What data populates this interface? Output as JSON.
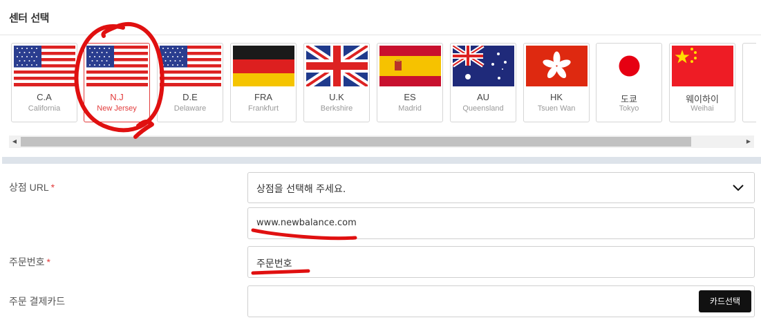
{
  "section": {
    "title": "센터 선택"
  },
  "centers": [
    {
      "code": "C.A",
      "city": "California",
      "flag": "us-flag"
    },
    {
      "code": "N.J",
      "city": "New Jersey",
      "flag": "us-flag",
      "selected": true
    },
    {
      "code": "D.E",
      "city": "Delaware",
      "flag": "us-flag"
    },
    {
      "code": "FRA",
      "city": "Frankfurt",
      "flag": "germany-flag"
    },
    {
      "code": "U.K",
      "city": "Berkshire",
      "flag": "uk-flag"
    },
    {
      "code": "ES",
      "city": "Madrid",
      "flag": "spain-flag"
    },
    {
      "code": "AU",
      "city": "Queensland",
      "flag": "australia-flag"
    },
    {
      "code": "HK",
      "city": "Tsuen Wan",
      "flag": "hong-kong-flag"
    },
    {
      "code": "도쿄",
      "city": "Tokyo",
      "flag": "japan-flag"
    },
    {
      "code": "웨이하이",
      "city": "Weihai",
      "flag": "china-flag"
    }
  ],
  "form": {
    "shop_url": {
      "label": "상점 URL",
      "required_mark": "*",
      "select_value": "상점을 선택해 주세요.",
      "url_value": "www.newbalance.com"
    },
    "order_number": {
      "label": "주문번호",
      "required_mark": "*",
      "value": "주문번호"
    },
    "payment_card": {
      "label": "주문 결제카드",
      "button_label": "카드선택"
    }
  },
  "colors": {
    "accent_red": "#e23b3b",
    "annotation_red": "#e01010",
    "button_bg": "#111111"
  }
}
